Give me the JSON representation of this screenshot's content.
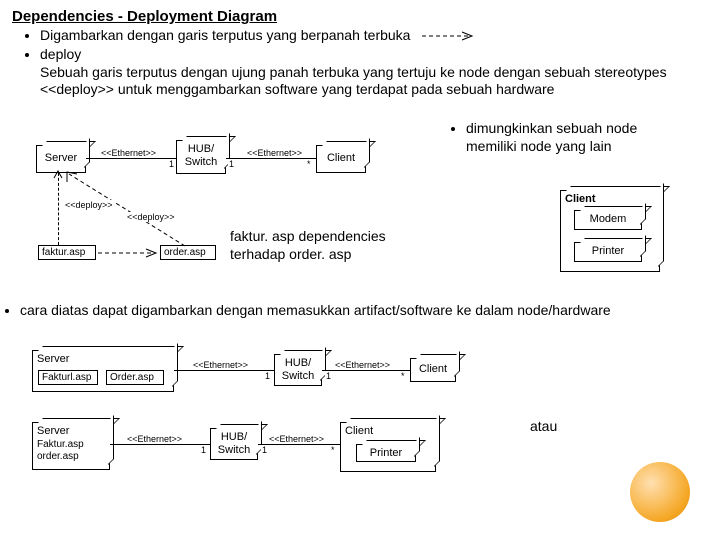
{
  "heading": "Dependencies - Deployment Diagram",
  "bullets": {
    "b1": "Digambarkan dengan garis terputus yang berpanah terbuka",
    "b2": "deploy",
    "b2_text": "Sebuah garis terputus dengan ujung panah terbuka yang tertuju ke node dengan sebuah stereotypes <<deploy>> untuk menggambarkan software yang terdapat pada sebuah hardware",
    "b3": "dimungkinkan sebuah node memiliki node yang lain"
  },
  "captions": {
    "dep": "faktur. asp dependencies terhadap order. asp",
    "bottom_bullet": "cara diatas dapat digambarkan dengan memasukkan artifact/software ke dalam node/hardware",
    "atau": "atau"
  },
  "diagram1": {
    "server": "Server",
    "hub": "HUB/\nSwitch",
    "client": "Client",
    "eth": "<<Ethernet>>",
    "one": "1",
    "star": "*",
    "faktur": "faktur.asp",
    "order": "order.asp",
    "deploy": "<<deploy>>"
  },
  "diagram2": {
    "client": "Client",
    "modem": "Modem",
    "printer": "Printer"
  },
  "diagram3a": {
    "server": "Server",
    "hub": "HUB/\nSwitch",
    "client": "Client",
    "eth": "<<Ethernet>>",
    "fakturl": "Fakturl.asp",
    "order": "Order.asp",
    "one": "1",
    "star": "*"
  },
  "diagram3b": {
    "server": "Server",
    "hub": "HUB/\nSwitch",
    "client": "Client",
    "printer": "Printer",
    "eth": "<<Ethernet>>",
    "faktur": "Faktur.asp",
    "order": "order.asp",
    "one": "1",
    "star": "*"
  }
}
